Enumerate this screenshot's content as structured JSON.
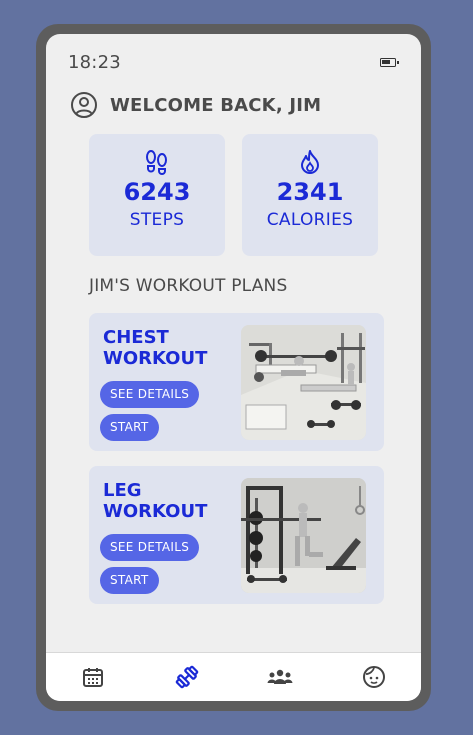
{
  "status": {
    "time": "18:23"
  },
  "header": {
    "welcome": "WELCOME BACK, JIM"
  },
  "stats": [
    {
      "value": "6243",
      "label": "STEPS",
      "icon": "footprints-icon"
    },
    {
      "value": "2341",
      "label": "CALORIES",
      "icon": "flame-icon"
    }
  ],
  "plans_section": {
    "title": "JIM'S WORKOUT PLANS"
  },
  "plans": [
    {
      "title": "CHEST WORKOUT",
      "details_label": "SEE DETAILS",
      "start_label": "START"
    },
    {
      "title": "LEG WORKOUT",
      "details_label": "SEE DETAILS",
      "start_label": "START"
    }
  ],
  "nav": {
    "items": [
      "calendar-icon",
      "dumbbell-icon",
      "group-icon",
      "face-icon"
    ],
    "active": "dumbbell-icon"
  },
  "colors": {
    "accent": "#1b2ad6",
    "button": "#5566e6",
    "card": "#dfe3ef",
    "background": "#6272a0"
  }
}
